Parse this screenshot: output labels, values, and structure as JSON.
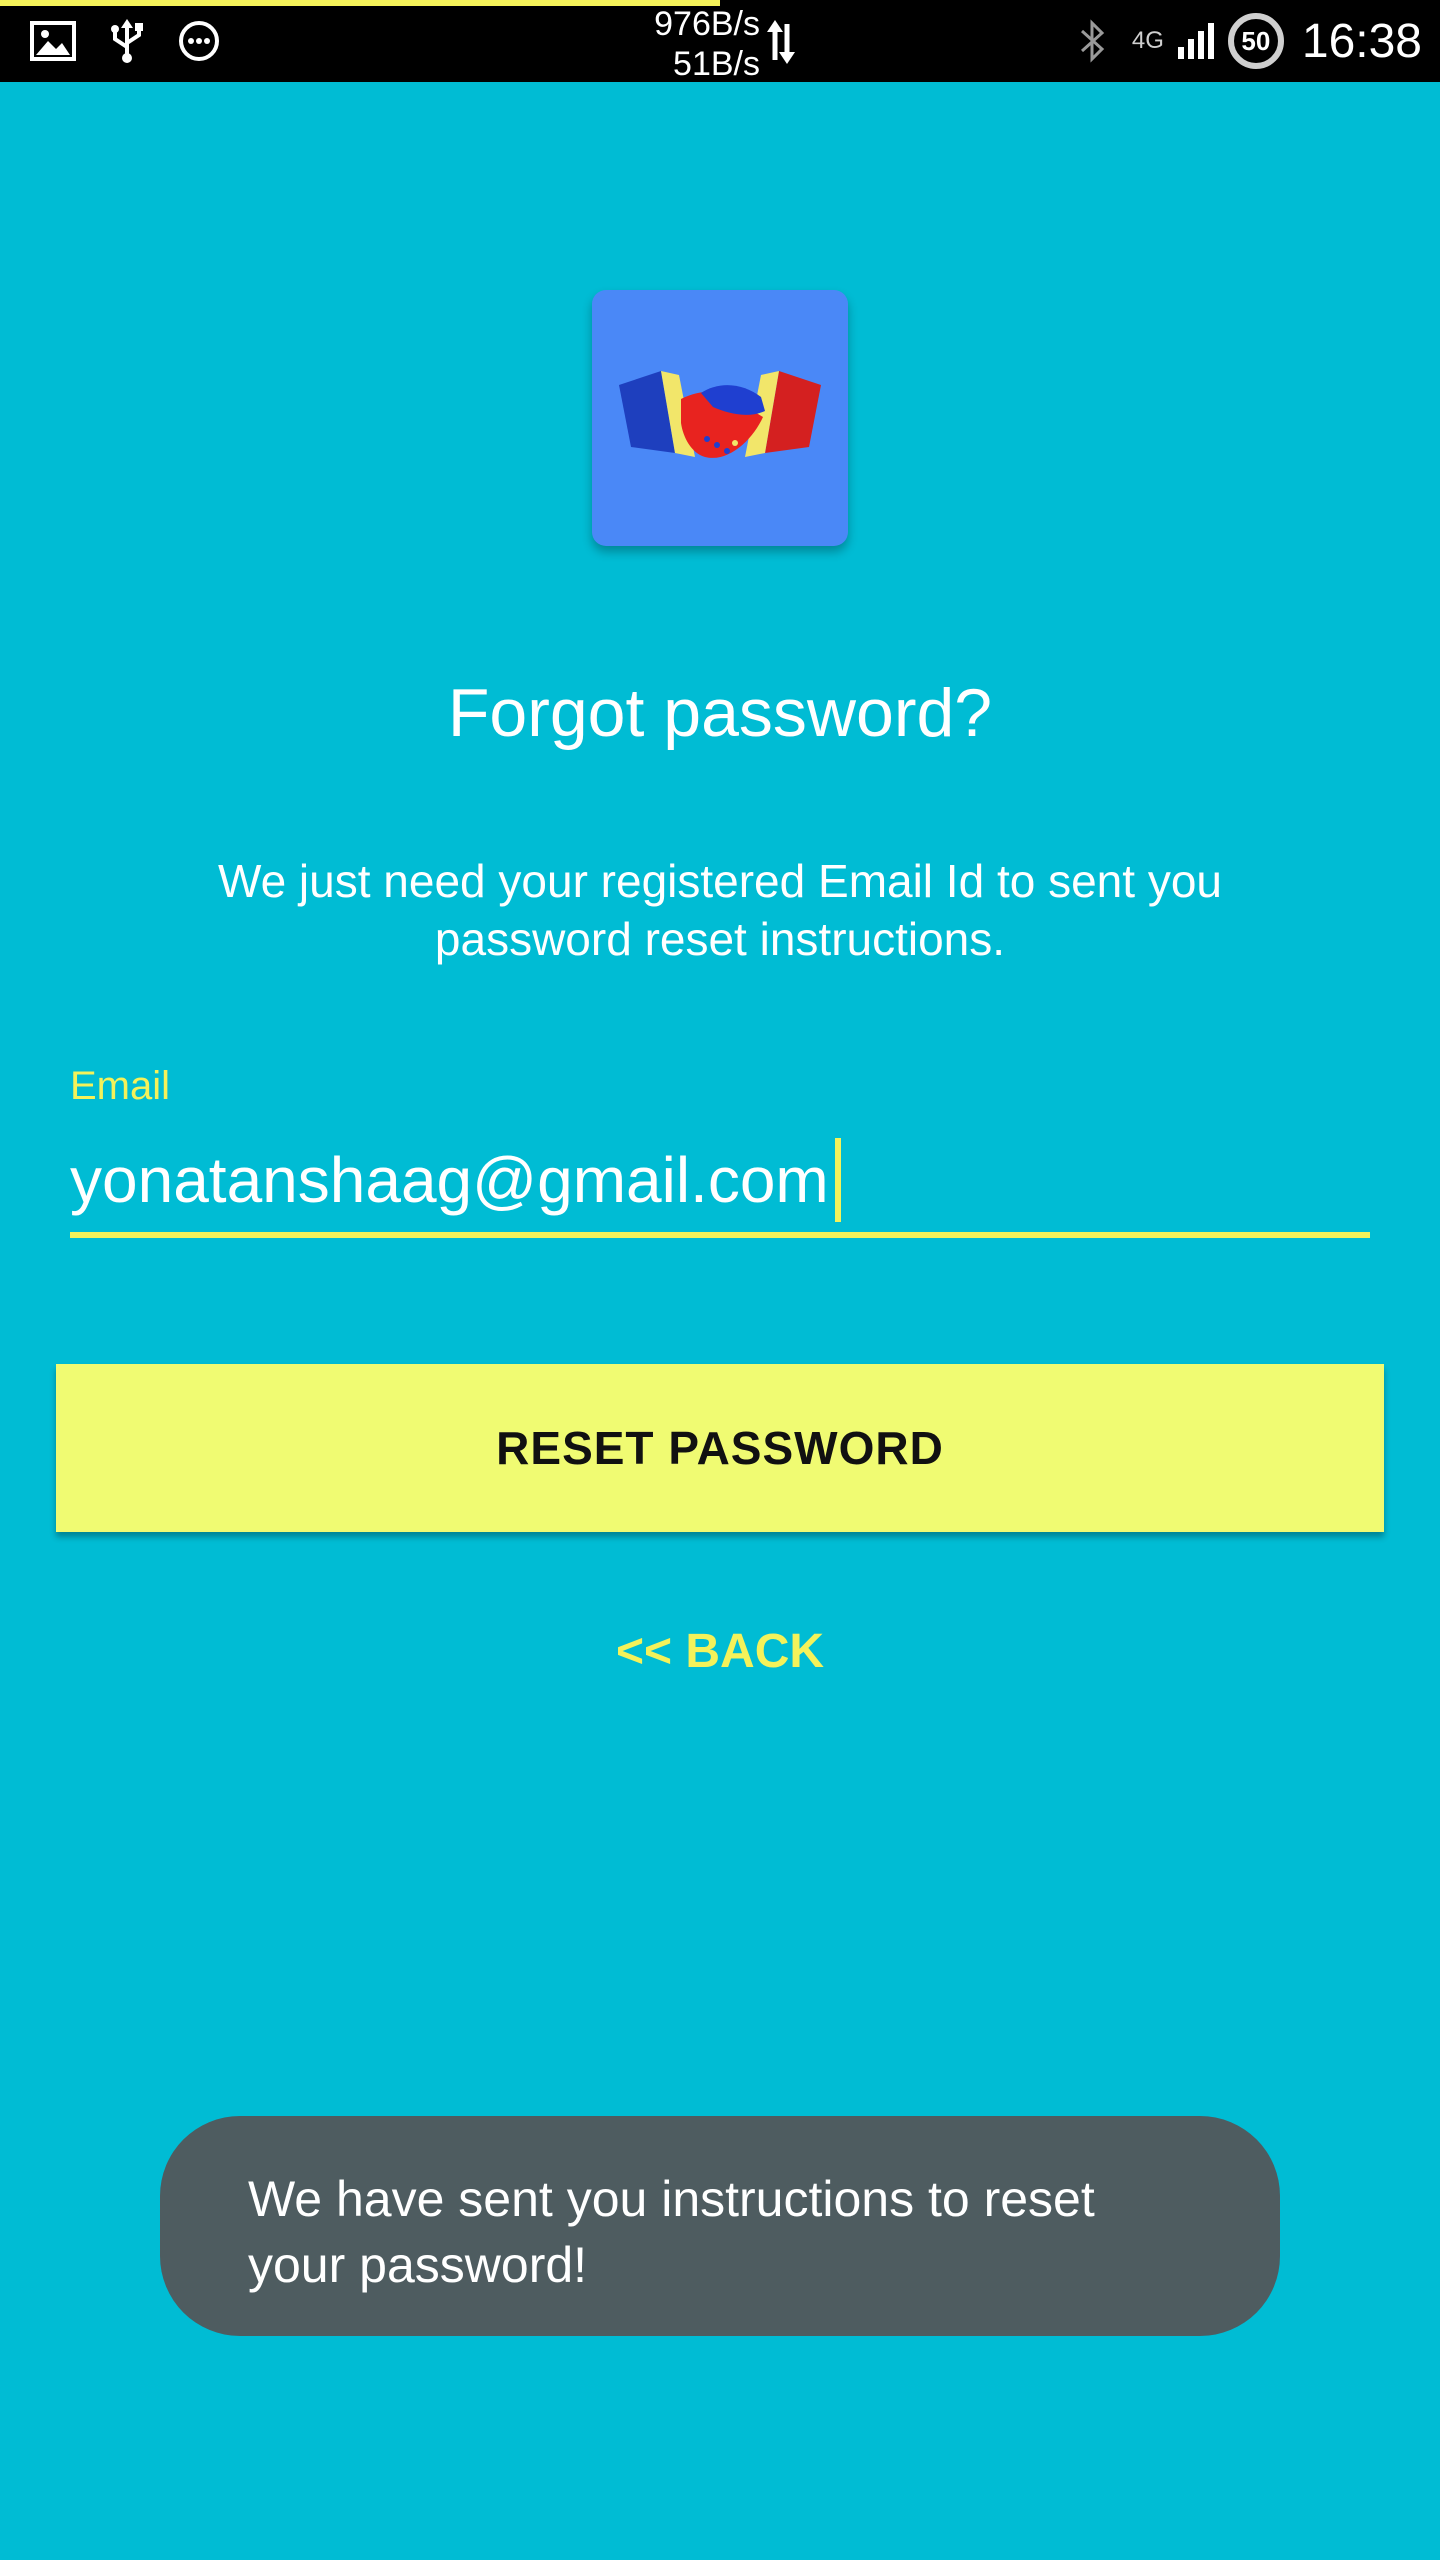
{
  "status_bar": {
    "download_speed": "976B/s",
    "upload_speed": "51B/s",
    "network_type": "4G",
    "battery_level": "50",
    "time": "16:38",
    "icons": [
      "image-icon",
      "usb-icon",
      "more-icon",
      "data-transfer-icon",
      "bluetooth-icon",
      "signal-icon",
      "battery-icon"
    ]
  },
  "app": {
    "logo_icon": "handshake-icon"
  },
  "header": {
    "title": "Forgot password?",
    "subtitle": "We just need your registered Email Id to sent you password reset instructions."
  },
  "form": {
    "email_label": "Email",
    "email_value": "yonatanshaag@gmail.com"
  },
  "actions": {
    "reset_label": "RESET PASSWORD",
    "back_label": "<< BACK"
  },
  "toast": {
    "message": "We have sent you instructions to reset your password!"
  },
  "colors": {
    "background": "#00BCD4",
    "accent": "#F4F25A",
    "button": "#F0FB72",
    "toast": "#4E5C60",
    "logo_bg": "#4A88F7"
  }
}
